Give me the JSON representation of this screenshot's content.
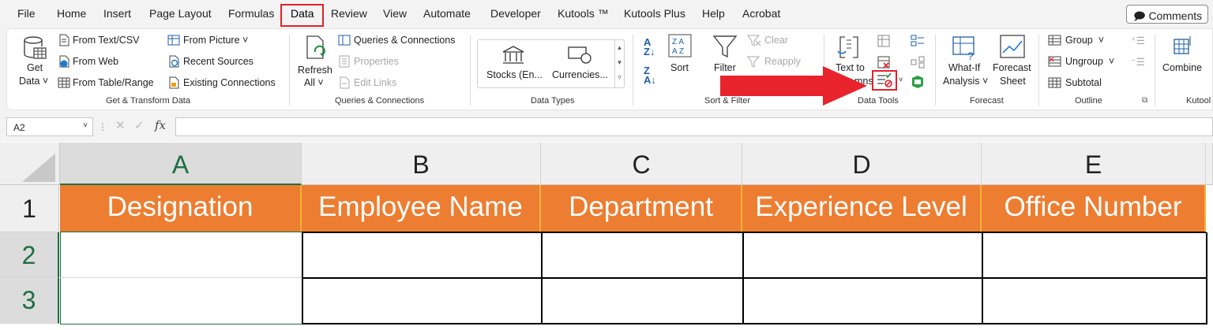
{
  "menu": {
    "items": [
      "File",
      "Home",
      "Insert",
      "Page Layout",
      "Formulas",
      "Data",
      "Review",
      "View",
      "Automate",
      "Developer",
      "Kutools ™",
      "Kutools Plus",
      "Help",
      "Acrobat"
    ],
    "active": "Data",
    "comments": "Comments"
  },
  "ribbon": {
    "get_transform": {
      "get_data": [
        "Get",
        "Data"
      ],
      "from_text_csv": "From Text/CSV",
      "from_web": "From Web",
      "from_table_range": "From Table/Range",
      "from_picture": "From Picture",
      "recent_sources": "Recent Sources",
      "existing_connections": "Existing Connections",
      "label": "Get & Transform Data"
    },
    "queries": {
      "refresh_all": [
        "Refresh",
        "All"
      ],
      "queries_connections": "Queries & Connections",
      "properties": "Properties",
      "edit_links": "Edit Links",
      "label": "Queries & Connections"
    },
    "data_types": {
      "stocks": "Stocks (En...",
      "currencies": "Currencies...",
      "label": "Data Types"
    },
    "sort_filter": {
      "sort": "Sort",
      "filter": "Filter",
      "clear": "Clear",
      "reapply": "Reapply",
      "label": "Sort & Filter"
    },
    "data_tools": {
      "text_to": "Text to",
      "columns_partial": "mns",
      "label": "Data Tools"
    },
    "forecast": {
      "what_if": [
        "What-If",
        "Analysis"
      ],
      "forecast_sheet": [
        "Forecast",
        "Sheet"
      ],
      "label": "Forecast"
    },
    "outline": {
      "group": "Group",
      "ungroup": "Ungroup",
      "subtotal": "Subtotal",
      "label": "Outline"
    },
    "kutools": {
      "combine": "Combine",
      "label": "Kutool"
    }
  },
  "formula_bar": {
    "name_box": "A2",
    "fx": "fx",
    "formula": ""
  },
  "sheet": {
    "columns": [
      "A",
      "B",
      "C",
      "D",
      "E"
    ],
    "selected_column": "A",
    "rows": [
      "1",
      "2",
      "3"
    ],
    "selected_rows": [
      "2",
      "3"
    ],
    "headers": [
      "Designation",
      "Employee Name",
      "Department",
      "Experience Level",
      "Office Number"
    ],
    "header_color": "#ed7d31"
  },
  "accent_colors": {
    "highlight_red": "#e2212b",
    "selection_green": "#1e6e42"
  }
}
